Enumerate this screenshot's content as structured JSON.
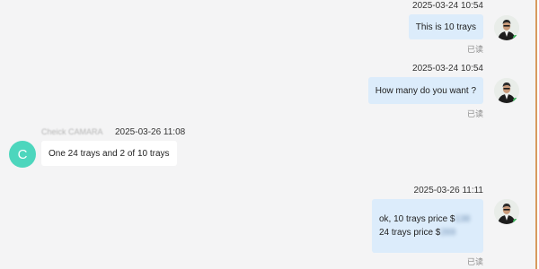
{
  "messages": [
    {
      "direction": "out",
      "time": "2025-03-24 10:54",
      "text": "This is 10 trays",
      "status": "已读"
    },
    {
      "direction": "out",
      "time": "2025-03-24 10:54",
      "text": "How many do you want ?",
      "status": "已读"
    },
    {
      "direction": "in",
      "sender": "Cheick CAMARA",
      "avatar_letter": "C",
      "time": "2025-03-26 11:08",
      "text": "One 24 trays and 2 of 10 trays"
    },
    {
      "direction": "out",
      "time": "2025-03-26 11:11",
      "line1_prefix": "ok, 10 trays  price $",
      "line1_price": "138",
      "line2_prefix": "24 trays  price $",
      "line2_price": "269",
      "status": "已读"
    }
  ],
  "colors": {
    "outgoing_bubble": "#dcecfb",
    "incoming_bubble": "#ffffff",
    "avatar_letter_bg": "#4dd6bd",
    "read_status": "#8a8a8a"
  },
  "icons": {
    "agent_avatar": "person-photo-avatar",
    "customer_avatar": "letter-avatar"
  }
}
